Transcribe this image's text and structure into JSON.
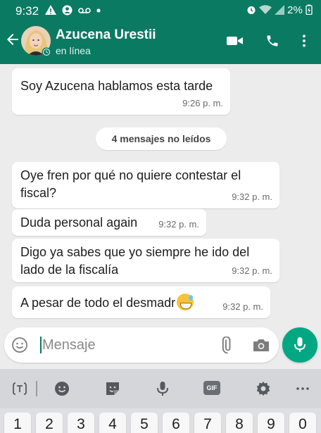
{
  "status_bar": {
    "time": "9:32",
    "icons": [
      "warning-icon",
      "account-icon",
      "voicemail-icon",
      "dot-icon"
    ],
    "battery": "2%"
  },
  "header": {
    "contact_name": "Azucena Urestii",
    "contact_status": "en línea",
    "background_color": "#0a7a63",
    "actions": [
      "video-call-icon",
      "phone-icon",
      "more-vert-icon"
    ]
  },
  "messages": [
    {
      "text": "Soy Azucena hablamos esta tarde",
      "time": "9:26 p. m."
    },
    {
      "text": "Oye fren por qué no quiere contestar el fiscal?",
      "time": "9:32 p. m."
    },
    {
      "text": "Duda personal again",
      "time": "9:32 p. m."
    },
    {
      "text": "Digo ya sabes que yo siempre he ido del lado de la fiscalía",
      "time": "9:32 p. m."
    },
    {
      "text": "A pesar de todo el desmadr",
      "time": "9:32 p. m.",
      "emoji": "grinning-sweat-emoji"
    }
  ],
  "unread_divider": "4 mensajes no leídos",
  "composer": {
    "placeholder": "Mensaje",
    "icons": [
      "emoji-icon",
      "attach-icon",
      "camera-icon",
      "mic-icon"
    ],
    "accent_color": "#00a783"
  },
  "keyboard": {
    "toolbar_icons": [
      "translate-icon",
      "emoji-icon",
      "sticker-icon",
      "mic-icon",
      "gif-icon",
      "settings-icon",
      "more-icon"
    ],
    "gif_label": "GIF",
    "number_row": [
      "1",
      "2",
      "3",
      "4",
      "5",
      "6",
      "7",
      "8",
      "9",
      "0"
    ]
  }
}
